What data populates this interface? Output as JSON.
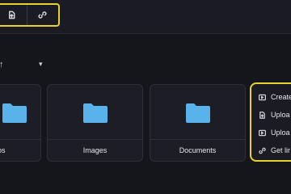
{
  "toolbar": {
    "buttons": [
      {
        "icon": "upload-file-icon"
      },
      {
        "icon": "link-icon"
      }
    ]
  },
  "sort": {
    "arrow": "↑",
    "caret": "▾"
  },
  "folders": [
    {
      "name": "os",
      "icon": "folder-icon"
    },
    {
      "name": "Images",
      "icon": "folder-icon"
    },
    {
      "name": "Documents",
      "icon": "folder-icon"
    }
  ],
  "menu": {
    "items": [
      {
        "label": "Create",
        "icon": "create-folder-icon"
      },
      {
        "label": "Uploa",
        "icon": "upload-file-icon"
      },
      {
        "label": "Uploa",
        "icon": "upload-folder-icon"
      },
      {
        "label": "Get lir",
        "icon": "link-icon"
      }
    ]
  },
  "colors": {
    "accent": "#e7d22a",
    "folder": "#5ab2ea",
    "background": "#15151c"
  }
}
